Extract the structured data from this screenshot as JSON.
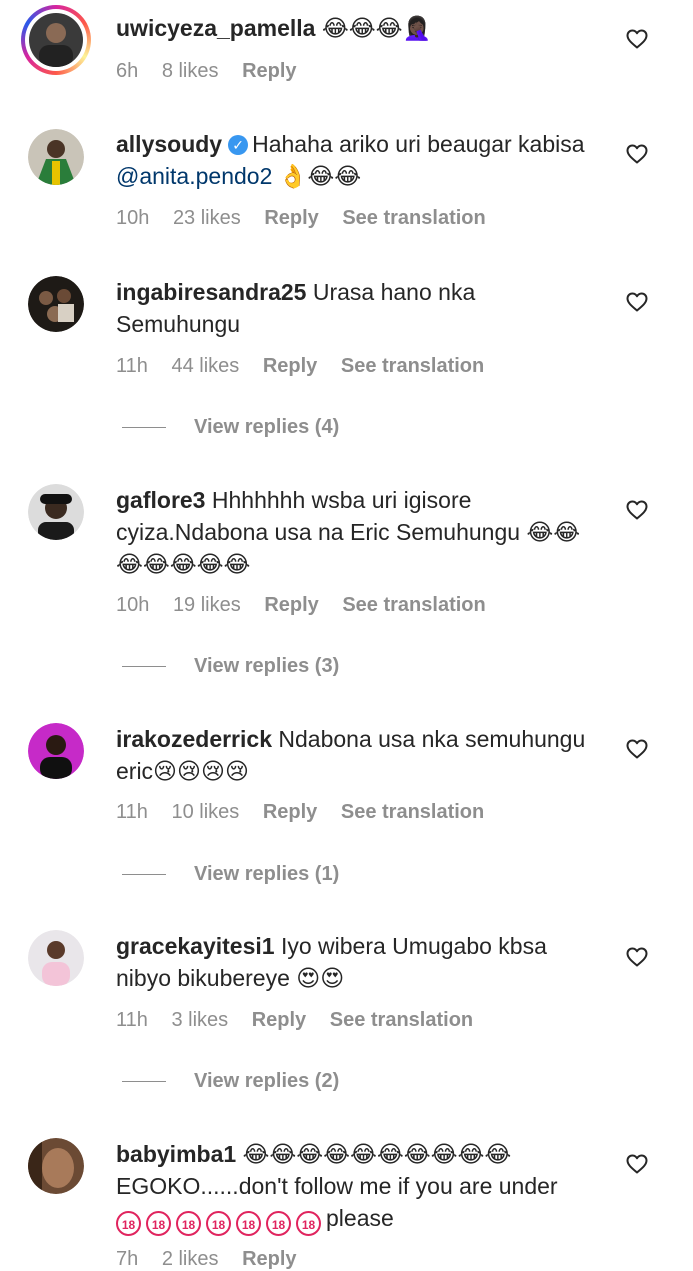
{
  "comments": [
    {
      "username": "uwicyeza_pamella",
      "verified": false,
      "text": "😂😂😂🤦🏿‍♀️",
      "time": "6h",
      "likes": "8 likes",
      "reply": "Reply",
      "translation": "",
      "replies": ""
    },
    {
      "username": "allysoudy",
      "verified": true,
      "text_before": "Hahaha ariko uri beaugar kabisa ",
      "mention": "@anita.pendo2",
      "text_after": " 👌😂😂",
      "time": "10h",
      "likes": "23 likes",
      "reply": "Reply",
      "translation": "See translation",
      "replies": ""
    },
    {
      "username": "ingabiresandra25",
      "verified": false,
      "text": "Urasa hano nka Semuhungu",
      "time": "11h",
      "likes": "44 likes",
      "reply": "Reply",
      "translation": "See translation",
      "replies": "View replies (4)"
    },
    {
      "username": "gaflore3",
      "verified": false,
      "text": "Hhhhhhh wsba uri igisore cyiza.Ndabona usa na Eric Semuhungu 😂😂😂😂😂😂😂",
      "time": "10h",
      "likes": "19 likes",
      "reply": "Reply",
      "translation": "See translation",
      "replies": "View replies (3)"
    },
    {
      "username": "irakozederrick",
      "verified": false,
      "text": "Ndabona usa nka semuhungu eric😢😢😢😢",
      "time": "11h",
      "likes": "10 likes",
      "reply": "Reply",
      "translation": "See translation",
      "replies": "View replies (1)"
    },
    {
      "username": "gracekayitesi1",
      "verified": false,
      "text": "Iyo wibera Umugabo kbsa nibyo bikubereye 😍😍",
      "time": "11h",
      "likes": "3 likes",
      "reply": "Reply",
      "translation": "See translation",
      "replies": "View replies (2)"
    },
    {
      "username": "babyimba1",
      "verified": false,
      "text_line1": "😂😂😂😂😂😂😂😂😂😂 EGOKO......don't follow me if you are under",
      "badge": "18",
      "text_end": "please",
      "time": "7h",
      "likes": "2 likes",
      "reply": "Reply",
      "translation": "",
      "replies": ""
    }
  ],
  "icons": {
    "like": "heart-outline-icon",
    "verified": "verified-badge-icon"
  },
  "colors": {
    "text": "#262626",
    "meta": "#8e8e8e",
    "mention": "#00376b",
    "verified": "#3897f0"
  }
}
